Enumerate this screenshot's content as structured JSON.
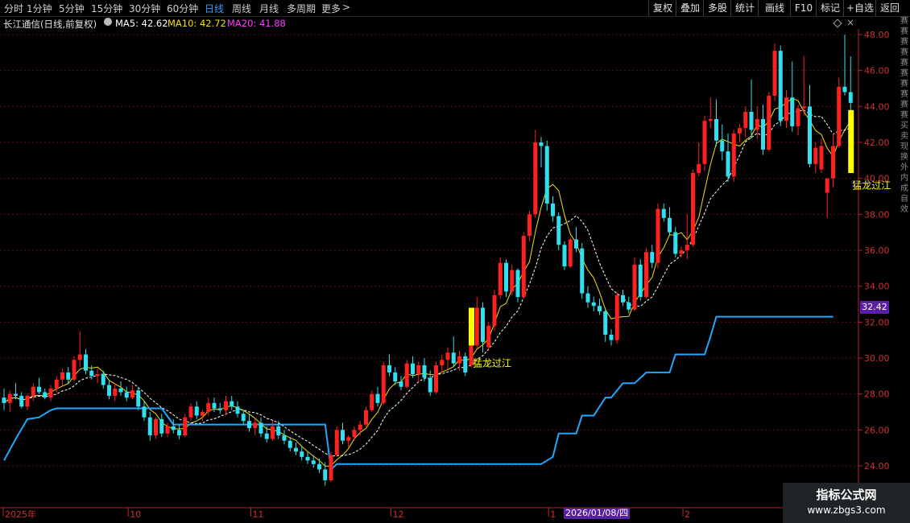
{
  "toolbar": {
    "periods": [
      "分时",
      "1分钟",
      "5分钟",
      "15分钟",
      "30分钟",
      "60分钟",
      "日线",
      "周线",
      "月线",
      "多周期",
      "更多"
    ],
    "active_period": "日线",
    "more_arrow": ">",
    "buttons": [
      "复权",
      "叠加",
      "多股",
      "统计",
      "画线",
      "F10",
      "标记",
      "+自选",
      "返回"
    ]
  },
  "info": {
    "title": "长江通信(日线,前复权)",
    "ma5_label": "MA5: 42.62",
    "ma10_label": "MA10: 42.72",
    "ma20_label": "MA20: 41.88",
    "ma5_color": "#ffffff",
    "ma10_color": "#f0e010",
    "ma20_color": "#ff3cff"
  },
  "price_tag": "32.42",
  "right_strip_text": "赛赛赛赛赛赛赛赛赛赛买卖现换外内成 自 效",
  "date_tag": "2026/01/08/四",
  "watermark": {
    "line1": "指标公式网",
    "line2": "www.zbgs3.com"
  },
  "chart_data": {
    "type": "candlestick",
    "y_ticks": [
      "48.00",
      "46.00",
      "44.00",
      "42.00",
      "40.00",
      "38.00",
      "36.00",
      "34.00",
      "32.00",
      "30.00",
      "28.00",
      "26.00",
      "24.00"
    ],
    "ylim": [
      22.5,
      48.5
    ],
    "x_tick_labels": [
      "2025年",
      "10",
      "11",
      "12",
      "1",
      "2"
    ],
    "signal_label": "猛龙过江",
    "colors": {
      "up": "#ff2020",
      "down": "#30e0f0",
      "signal": "#ffff00",
      "support": "#20a8ff",
      "ma_fast": "#f0e010",
      "ma_slow": "#ffffff"
    },
    "candles": [
      [
        27.8,
        28.3,
        27.1,
        27.5
      ],
      [
        27.5,
        28.2,
        27.0,
        28.0
      ],
      [
        28.0,
        28.6,
        27.7,
        27.9
      ],
      [
        27.9,
        28.1,
        27.2,
        27.3
      ],
      [
        27.3,
        28.0,
        27.1,
        27.9
      ],
      [
        27.9,
        28.6,
        27.6,
        28.4
      ],
      [
        28.4,
        28.9,
        28.0,
        28.1
      ],
      [
        28.1,
        28.3,
        27.7,
        27.8
      ],
      [
        27.8,
        28.5,
        27.6,
        28.3
      ],
      [
        28.3,
        29.0,
        28.1,
        28.8
      ],
      [
        28.8,
        29.4,
        28.5,
        29.2
      ],
      [
        29.2,
        29.5,
        28.6,
        28.8
      ],
      [
        28.8,
        30.1,
        28.7,
        29.9
      ],
      [
        29.9,
        31.5,
        29.5,
        30.2
      ],
      [
        30.2,
        30.5,
        29.1,
        29.3
      ],
      [
        29.3,
        29.6,
        28.8,
        29.0
      ],
      [
        29.0,
        29.4,
        28.6,
        29.1
      ],
      [
        29.1,
        29.3,
        28.3,
        28.5
      ],
      [
        28.5,
        28.8,
        27.7,
        27.9
      ],
      [
        27.9,
        28.6,
        27.6,
        28.3
      ],
      [
        28.3,
        28.7,
        27.9,
        28.1
      ],
      [
        28.1,
        28.4,
        27.6,
        27.8
      ],
      [
        27.8,
        28.5,
        27.7,
        28.2
      ],
      [
        28.2,
        28.4,
        27.1,
        27.3
      ],
      [
        27.3,
        27.6,
        26.5,
        26.7
      ],
      [
        26.7,
        27.0,
        25.4,
        25.7
      ],
      [
        25.7,
        26.7,
        25.5,
        26.6
      ],
      [
        26.6,
        26.9,
        25.6,
        25.8
      ],
      [
        25.8,
        26.4,
        25.6,
        26.2
      ],
      [
        26.2,
        26.6,
        25.8,
        26.0
      ],
      [
        26.0,
        26.3,
        25.5,
        25.7
      ],
      [
        25.7,
        26.9,
        25.6,
        26.7
      ],
      [
        26.7,
        27.5,
        26.5,
        27.3
      ],
      [
        27.3,
        27.6,
        26.6,
        26.8
      ],
      [
        26.8,
        27.1,
        26.5,
        27.0
      ],
      [
        27.0,
        27.8,
        26.8,
        27.5
      ],
      [
        27.5,
        27.8,
        27.0,
        27.2
      ],
      [
        27.2,
        27.5,
        26.9,
        27.1
      ],
      [
        27.1,
        27.9,
        26.8,
        27.6
      ],
      [
        27.6,
        27.9,
        27.1,
        27.3
      ],
      [
        27.3,
        27.6,
        26.7,
        26.9
      ],
      [
        26.9,
        27.1,
        26.3,
        26.5
      ],
      [
        26.5,
        26.9,
        25.9,
        26.1
      ],
      [
        26.1,
        26.6,
        25.7,
        26.4
      ],
      [
        26.4,
        26.7,
        25.6,
        25.8
      ],
      [
        25.8,
        26.2,
        25.3,
        25.5
      ],
      [
        25.5,
        26.5,
        25.4,
        26.2
      ],
      [
        26.2,
        26.5,
        25.5,
        25.7
      ],
      [
        25.7,
        26.0,
        25.2,
        25.4
      ],
      [
        25.4,
        25.6,
        24.8,
        25.0
      ],
      [
        25.0,
        25.3,
        24.6,
        24.8
      ],
      [
        24.8,
        25.1,
        24.3,
        24.5
      ],
      [
        24.5,
        24.8,
        24.1,
        24.3
      ],
      [
        24.3,
        24.6,
        23.9,
        24.1
      ],
      [
        24.1,
        24.4,
        23.6,
        23.8
      ],
      [
        23.8,
        24.2,
        22.9,
        23.2
      ],
      [
        23.2,
        24.8,
        23.1,
        24.6
      ],
      [
        24.6,
        26.2,
        24.5,
        26.0
      ],
      [
        26.0,
        26.4,
        25.2,
        25.4
      ],
      [
        25.4,
        25.7,
        25.0,
        25.6
      ],
      [
        25.6,
        26.2,
        25.4,
        26.0
      ],
      [
        26.0,
        26.5,
        25.7,
        26.3
      ],
      [
        26.3,
        27.3,
        26.2,
        27.1
      ],
      [
        27.1,
        28.2,
        27.0,
        28.0
      ],
      [
        28.0,
        28.4,
        27.3,
        27.5
      ],
      [
        27.5,
        29.8,
        27.4,
        29.6
      ],
      [
        29.6,
        30.2,
        29.0,
        29.2
      ],
      [
        29.2,
        29.5,
        28.5,
        28.7
      ],
      [
        28.7,
        29.0,
        28.2,
        28.4
      ],
      [
        28.4,
        29.9,
        28.3,
        29.7
      ],
      [
        29.7,
        30.1,
        28.9,
        29.1
      ],
      [
        29.1,
        29.8,
        28.6,
        29.6
      ],
      [
        29.6,
        30.0,
        28.7,
        28.9
      ],
      [
        28.9,
        29.3,
        27.9,
        28.1
      ],
      [
        28.1,
        29.8,
        28.0,
        29.6
      ],
      [
        29.6,
        30.2,
        29.2,
        29.9
      ],
      [
        29.9,
        30.6,
        29.4,
        30.3
      ],
      [
        30.3,
        31.2,
        29.5,
        29.7
      ],
      [
        29.7,
        30.4,
        29.3,
        30.1
      ],
      [
        30.1,
        30.3,
        29.0,
        29.2
      ],
      [
        29.6,
        31.9,
        29.5,
        30.7
      ],
      [
        30.7,
        33.4,
        30.5,
        32.8
      ],
      [
        32.8,
        33.1,
        30.3,
        30.9
      ],
      [
        30.6,
        32.0,
        30.4,
        31.8
      ],
      [
        31.8,
        33.8,
        31.5,
        33.5
      ],
      [
        33.5,
        35.6,
        33.3,
        35.3
      ],
      [
        35.3,
        35.5,
        33.4,
        33.7
      ],
      [
        33.7,
        35.2,
        33.5,
        34.9
      ],
      [
        34.9,
        35.0,
        33.1,
        33.4
      ],
      [
        33.4,
        37.0,
        33.3,
        36.8
      ],
      [
        36.8,
        38.2,
        36.5,
        38.0
      ],
      [
        38.0,
        42.7,
        37.8,
        42.0
      ],
      [
        42.0,
        42.3,
        40.6,
        41.8
      ],
      [
        41.8,
        42.1,
        38.2,
        38.6
      ],
      [
        38.6,
        39.0,
        37.6,
        37.9
      ],
      [
        37.9,
        38.1,
        36.0,
        36.3
      ],
      [
        36.3,
        36.5,
        34.9,
        35.1
      ],
      [
        35.1,
        36.7,
        35.0,
        36.6
      ],
      [
        36.6,
        37.3,
        35.9,
        36.1
      ],
      [
        36.1,
        36.4,
        33.3,
        33.6
      ],
      [
        33.6,
        34.0,
        32.8,
        33.1
      ],
      [
        33.1,
        33.4,
        32.6,
        32.9
      ],
      [
        32.9,
        33.3,
        32.4,
        32.6
      ],
      [
        32.6,
        32.8,
        30.9,
        31.3
      ],
      [
        31.3,
        31.6,
        30.7,
        31.0
      ],
      [
        31.0,
        33.7,
        30.8,
        33.5
      ],
      [
        33.5,
        33.8,
        32.9,
        33.1
      ],
      [
        33.1,
        33.4,
        32.5,
        32.7
      ],
      [
        32.7,
        35.6,
        32.6,
        35.2
      ],
      [
        35.2,
        35.5,
        33.2,
        33.4
      ],
      [
        33.4,
        36.1,
        33.3,
        35.9
      ],
      [
        35.9,
        36.3,
        35.0,
        35.3
      ],
      [
        35.3,
        38.6,
        35.0,
        38.3
      ],
      [
        38.3,
        38.6,
        37.6,
        37.8
      ],
      [
        37.8,
        38.4,
        36.8,
        37.0
      ],
      [
        37.0,
        37.3,
        35.6,
        35.8
      ],
      [
        35.8,
        36.2,
        35.6,
        36.0
      ],
      [
        36.0,
        38.0,
        35.5,
        36.3
      ],
      [
        36.3,
        40.5,
        36.2,
        40.3
      ],
      [
        40.3,
        42.0,
        40.1,
        40.8
      ],
      [
        40.8,
        43.5,
        40.4,
        43.2
      ],
      [
        43.2,
        44.5,
        42.8,
        43.3
      ],
      [
        43.3,
        44.4,
        41.8,
        42.1
      ],
      [
        42.1,
        43.0,
        41.0,
        41.5
      ],
      [
        41.5,
        42.5,
        39.8,
        40.1
      ],
      [
        40.1,
        42.7,
        39.8,
        42.5
      ],
      [
        42.5,
        43.0,
        42.0,
        42.8
      ],
      [
        42.8,
        44.0,
        42.3,
        43.7
      ],
      [
        43.7,
        45.5,
        42.2,
        42.7
      ],
      [
        42.7,
        44.0,
        42.2,
        43.3
      ],
      [
        43.3,
        44.1,
        41.3,
        41.6
      ],
      [
        41.6,
        44.8,
        41.5,
        44.6
      ],
      [
        44.6,
        47.5,
        44.3,
        47.1
      ],
      [
        47.1,
        47.4,
        42.9,
        43.2
      ],
      [
        43.2,
        44.9,
        42.8,
        44.5
      ],
      [
        44.5,
        46.5,
        42.6,
        42.9
      ],
      [
        42.9,
        44.1,
        42.4,
        43.9
      ],
      [
        43.9,
        46.8,
        43.5,
        44.0
      ],
      [
        44.0,
        45.2,
        40.6,
        40.8
      ],
      [
        40.8,
        42.0,
        40.3,
        41.7
      ],
      [
        40.5,
        42.2,
        40.3,
        41.8
      ],
      [
        39.2,
        39.7,
        37.8,
        40.0
      ],
      [
        40.0,
        42.5,
        39.5,
        41.8
      ],
      [
        41.8,
        45.6,
        41.7,
        45.1
      ],
      [
        45.1,
        48.0,
        44.6,
        44.8
      ],
      [
        44.8,
        46.8,
        43.6,
        44.2
      ]
    ],
    "signal_bars": [
      {
        "index": 80,
        "low": 30.7,
        "high": 32.8
      },
      {
        "index": 145,
        "low": 40.3,
        "high": 43.8
      }
    ],
    "signal_label_positions": [
      {
        "index": 80,
        "y": 29.7
      },
      {
        "index": 145,
        "y": 39.6
      }
    ],
    "support_line": [
      [
        0,
        24.3
      ],
      [
        2,
        25.5
      ],
      [
        4,
        26.6
      ],
      [
        6,
        26.7
      ],
      [
        8,
        27.1
      ],
      [
        9,
        27.2
      ],
      [
        27,
        27.2
      ],
      [
        29,
        26.3
      ],
      [
        55,
        26.3
      ],
      [
        56,
        23.8
      ],
      [
        57,
        24.1
      ],
      [
        92,
        24.1
      ],
      [
        94,
        24.5
      ],
      [
        95,
        25.8
      ],
      [
        98,
        25.8
      ],
      [
        99,
        26.8
      ],
      [
        101,
        26.8
      ],
      [
        103,
        27.8
      ],
      [
        104,
        27.8
      ],
      [
        106,
        28.6
      ],
      [
        108,
        28.6
      ],
      [
        110,
        29.2
      ],
      [
        114,
        29.2
      ],
      [
        115,
        30.2
      ],
      [
        120,
        30.2
      ],
      [
        121,
        31.2
      ],
      [
        122,
        32.3
      ],
      [
        142,
        32.3
      ]
    ]
  }
}
